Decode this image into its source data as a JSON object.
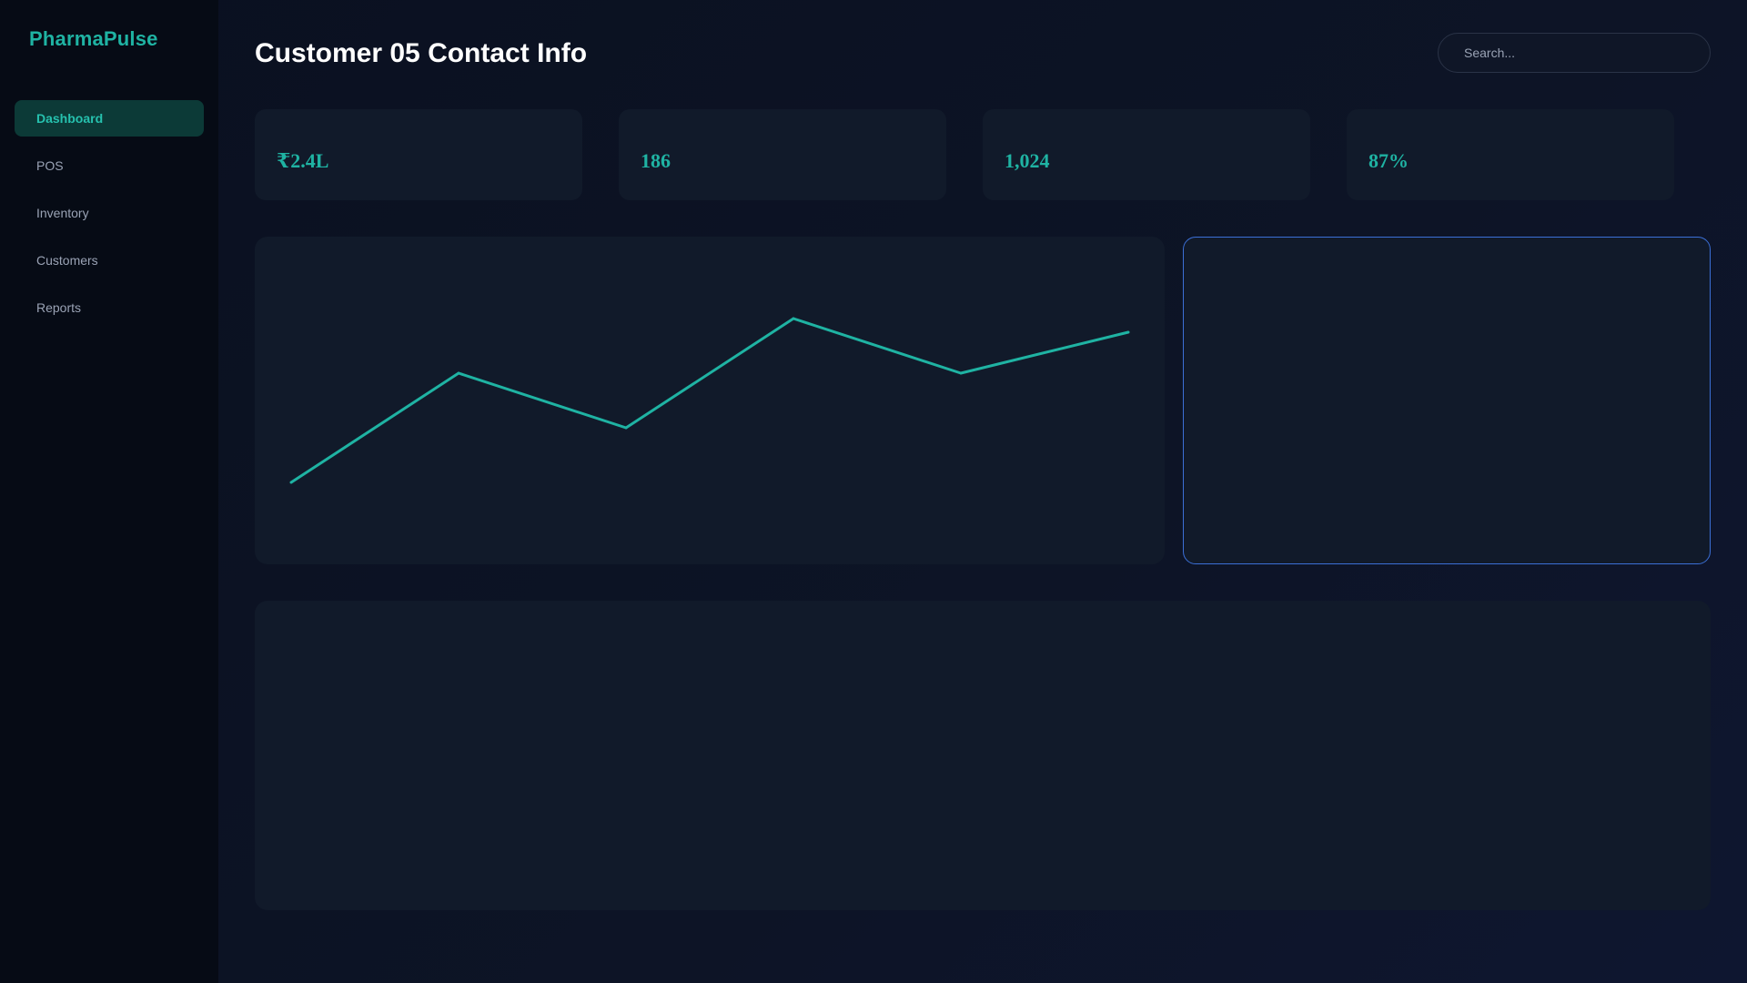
{
  "app": {
    "name": "PharmaPulse"
  },
  "sidebar": {
    "items": [
      {
        "label": "Dashboard",
        "active": true
      },
      {
        "label": "POS",
        "active": false
      },
      {
        "label": "Inventory",
        "active": false
      },
      {
        "label": "Customers",
        "active": false
      },
      {
        "label": "Reports",
        "active": false
      }
    ]
  },
  "header": {
    "title": "Customer 05 Contact Info",
    "search_placeholder": "Search..."
  },
  "stats": [
    {
      "value": "₹2.4L"
    },
    {
      "value": "186"
    },
    {
      "value": "1,024"
    },
    {
      "value": "87%"
    }
  ],
  "colors": {
    "accent": "#1fb3a3",
    "focus_border": "#3b6fd6"
  },
  "chart_data": {
    "type": "line",
    "title": "",
    "xlabel": "",
    "ylabel": "",
    "x": [
      1,
      2,
      3,
      4,
      5,
      6
    ],
    "series": [
      {
        "values": [
          1,
          5,
          3,
          7,
          5,
          6.5
        ]
      }
    ],
    "ylim": [
      0,
      8
    ],
    "grid": false,
    "color": "#1fb3a3"
  }
}
